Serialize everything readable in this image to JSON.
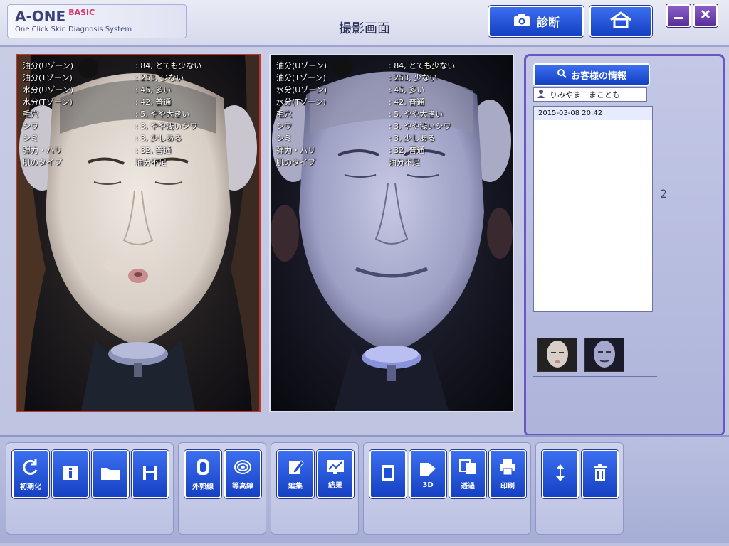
{
  "app": {
    "name": "A-ONE",
    "edition": "BASIC",
    "tagline": "One Click Skin Diagnosis System"
  },
  "header": {
    "title": "撮影画面",
    "diagnose_label": "診断"
  },
  "panels": {
    "left": {
      "readings": [
        {
          "label": "油分(Uゾーン)",
          "value": ": 84, とても少ない"
        },
        {
          "label": "油分(Tゾーン)",
          "value": ": 253, 少ない"
        },
        {
          "label": "水分(Uゾーン)",
          "value": ": 45, 多い"
        },
        {
          "label": "水分(Tゾーン)",
          "value": ": 42, 普通"
        },
        {
          "label": "毛穴",
          "value": ": 5, やや大きい"
        },
        {
          "label": "シワ",
          "value": ": 3, やや浅いシワ"
        },
        {
          "label": "シミ",
          "value": ": 3, 少しある"
        },
        {
          "label": "弾力・ハリ",
          "value": ": 32, 普通"
        },
        {
          "label": "肌のタイプ",
          "value": "油分不足"
        }
      ]
    },
    "right": {
      "readings": [
        {
          "label": "油分(Uゾーン)",
          "value": ": 84, とても少ない"
        },
        {
          "label": "油分(Tゾーン)",
          "value": ": 253, 少ない"
        },
        {
          "label": "水分(Uゾーン)",
          "value": ": 45, 多い"
        },
        {
          "label": "水分(Tゾーン)",
          "value": ": 42, 普通"
        },
        {
          "label": "毛穴",
          "value": ": 5, やや大きい"
        },
        {
          "label": "シワ",
          "value": ": 3, やや浅いシワ"
        },
        {
          "label": "シミ",
          "value": ": 3, 少しある"
        },
        {
          "label": "弾力・ハリ",
          "value": ": 32, 普通"
        },
        {
          "label": "肌のタイプ",
          "value": "油分不足"
        }
      ]
    }
  },
  "sidebar": {
    "customer_info_label": "お客様の情報",
    "customer_name": "りみやま　まことも",
    "sessions": [
      "2015-03-08 20:42"
    ],
    "side_number": "2"
  },
  "toolbar": {
    "init_label": "初期化",
    "outer_line_label": "外郭線",
    "contour_label": "等高線",
    "edit_label": "編集",
    "result_label": "結果",
    "threed_label": "3D",
    "transparent_label": "透過",
    "print_label": "印刷"
  },
  "colors": {
    "button_blue": "#1f4fd6",
    "selected_panel_border": "#c0392b",
    "sidebar_border": "#6a56c4"
  }
}
